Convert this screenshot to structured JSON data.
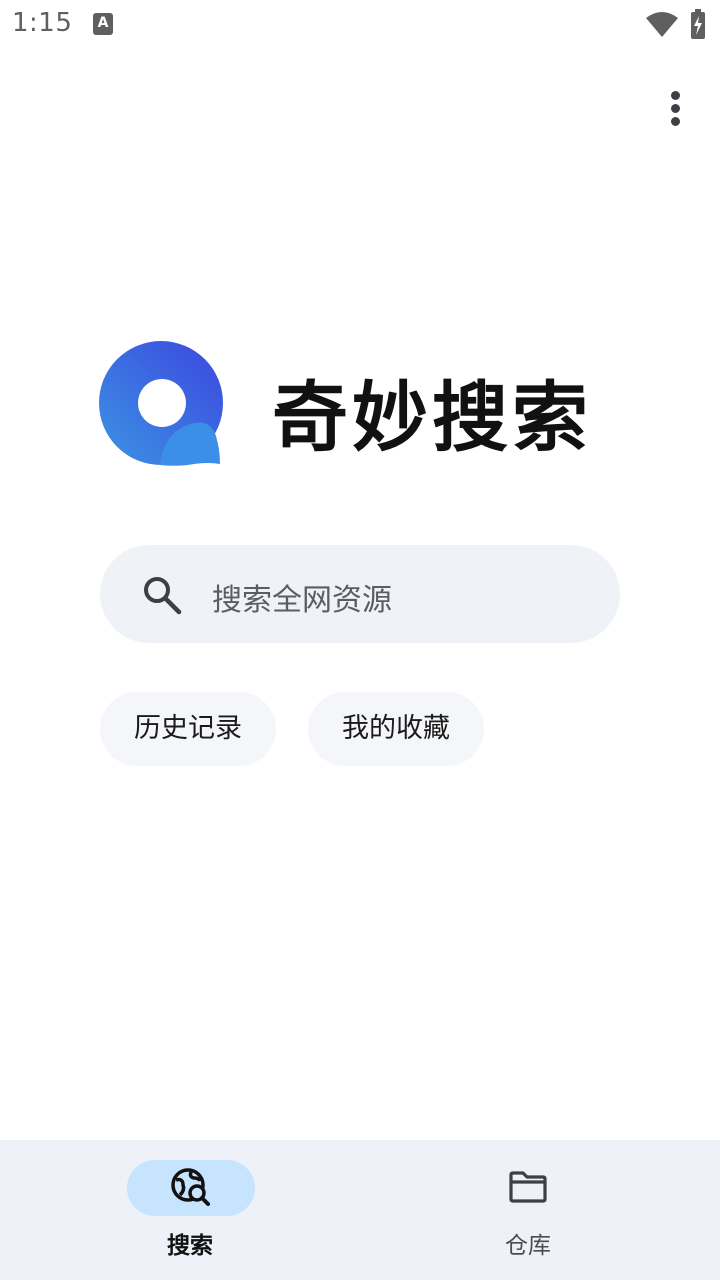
{
  "status_bar": {
    "time": "1:15",
    "notification_icon": "A"
  },
  "app": {
    "title": "奇妙搜索",
    "brand_colors": {
      "logo_start": "#3a8ee6",
      "logo_end": "#3a4fe0"
    }
  },
  "search": {
    "placeholder": "搜索全网资源"
  },
  "quick_links": [
    {
      "label": "历史记录"
    },
    {
      "label": "我的收藏"
    }
  ],
  "bottom_nav": {
    "items": [
      {
        "label": "搜索",
        "icon": "globe-search-icon",
        "active": true
      },
      {
        "label": "仓库",
        "icon": "folder-icon",
        "active": false
      }
    ],
    "active_pill_color": "#c7e4ff"
  }
}
